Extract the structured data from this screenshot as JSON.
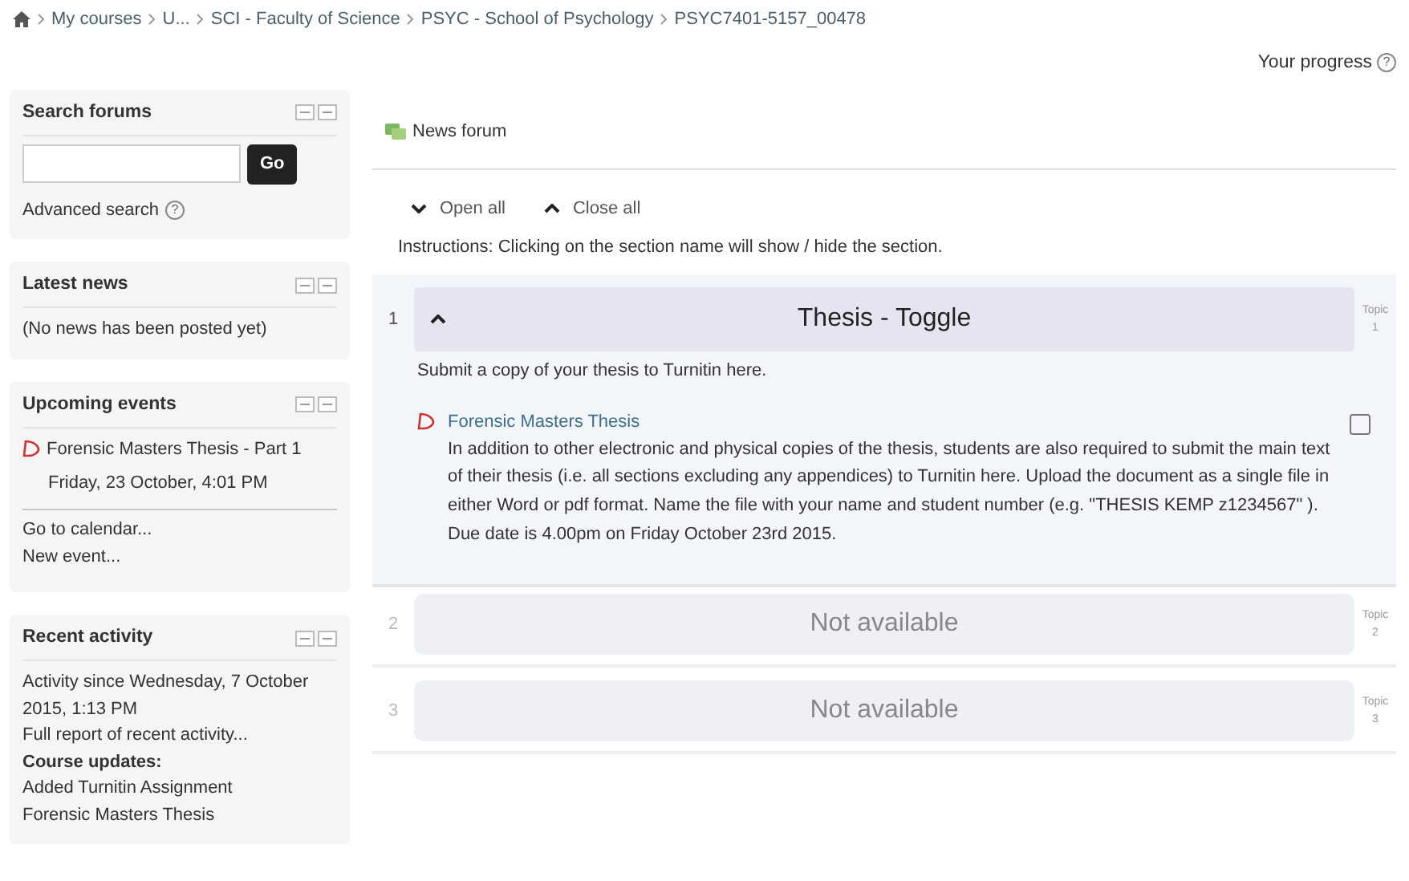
{
  "breadcrumb": [
    "My courses",
    "U...",
    "SCI - Faculty of Science",
    "PSYC - School of Psychology",
    "PSYC7401-5157_00478"
  ],
  "progress": {
    "label": "Your progress",
    "help": "?"
  },
  "sidebar": [
    {
      "kind": "search",
      "title": "Search forums",
      "button": "Go",
      "link": "Advanced search",
      "help": "?"
    },
    {
      "kind": "text",
      "title": "Latest news",
      "text": "(No news has been posted yet)"
    },
    {
      "kind": "events",
      "title": "Upcoming events",
      "event": "Forensic Masters Thesis - Part 1",
      "date": "Friday, 23 October, 4:01 PM",
      "links": [
        "Go to calendar...",
        "New event..."
      ]
    },
    {
      "kind": "activity",
      "title": "Recent activity",
      "since": "Activity since Wednesday, 7 October 2015, 1:13 PM",
      "report": "Full report of recent activity...",
      "heading": "Course updates:",
      "update": "Added Turnitin Assignment",
      "update_link": "Forensic Masters Thesis"
    }
  ],
  "news_forum": "News forum",
  "open_all": "Open all",
  "close_all": "Close all",
  "instructions": "Instructions: Clicking on the section name will show / hide the section.",
  "sections": [
    {
      "number": "1",
      "title": "Thesis - Toggle",
      "available": true,
      "expanded": true,
      "side_label": "Topic",
      "side_number": "1",
      "summary": "Submit a copy of your thesis to Turnitin here.",
      "activity": {
        "name": "Forensic Masters Thesis",
        "description": "In addition to other electronic and physical copies of the thesis, students are also required to submit the main text of their thesis (i.e. all sections excluding any appendices) to Turnitin here. Upload the document as a single file in either Word or pdf format.  Name the file with your name and student number (e.g. \"THESIS KEMP z1234567\" ). Due date is 4.00pm on Friday October 23rd 2015.",
        "checked": false
      }
    },
    {
      "number": "2",
      "title": "Not available",
      "available": false,
      "side_label": "Topic",
      "side_number": "2"
    },
    {
      "number": "3",
      "title": "Not available",
      "available": false,
      "side_label": "Topic",
      "side_number": "3"
    }
  ]
}
